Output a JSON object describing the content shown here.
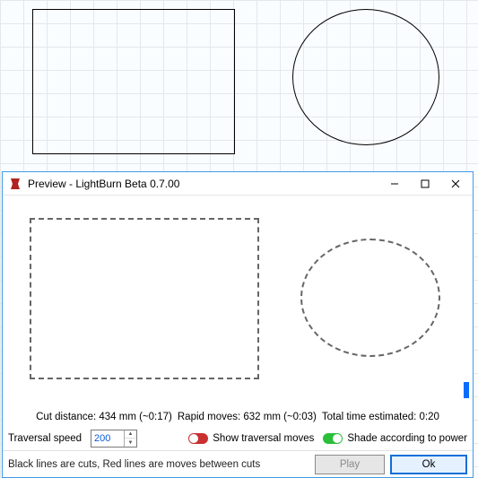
{
  "window": {
    "title": "Preview - LightBurn Beta 0.7.00"
  },
  "stats": {
    "cut_distance": "Cut distance: 434 mm (~0:17)",
    "rapid_moves": "Rapid moves: 632 mm (~0:03)",
    "total_time": "Total time estimated: 0:20"
  },
  "controls": {
    "traversal_label": "Traversal speed",
    "traversal_value": "200",
    "show_traversal_label": "Show traversal moves",
    "shade_label": "Shade according to power"
  },
  "footer": {
    "hint": "Black lines are cuts, Red lines are moves between cuts",
    "play_label": "Play",
    "ok_label": "Ok"
  }
}
